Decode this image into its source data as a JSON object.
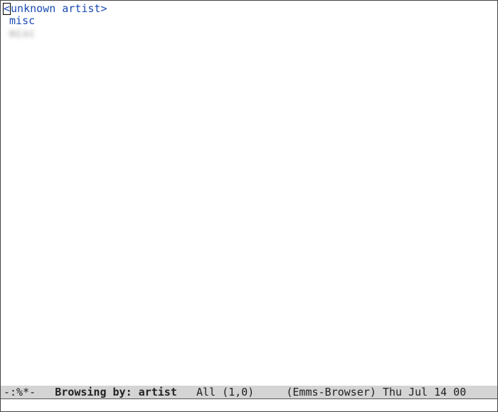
{
  "buffer": {
    "artist": "unknown artist>",
    "cursor_char": "<",
    "album": "misc",
    "track": "misc"
  },
  "modeline": {
    "prefix": "-:%*-",
    "title": "Browsing by: artist",
    "position": "All",
    "coords": "(1,0)",
    "mode": "(Emms-Browser)",
    "datetime": "Thu Jul 14 00"
  }
}
